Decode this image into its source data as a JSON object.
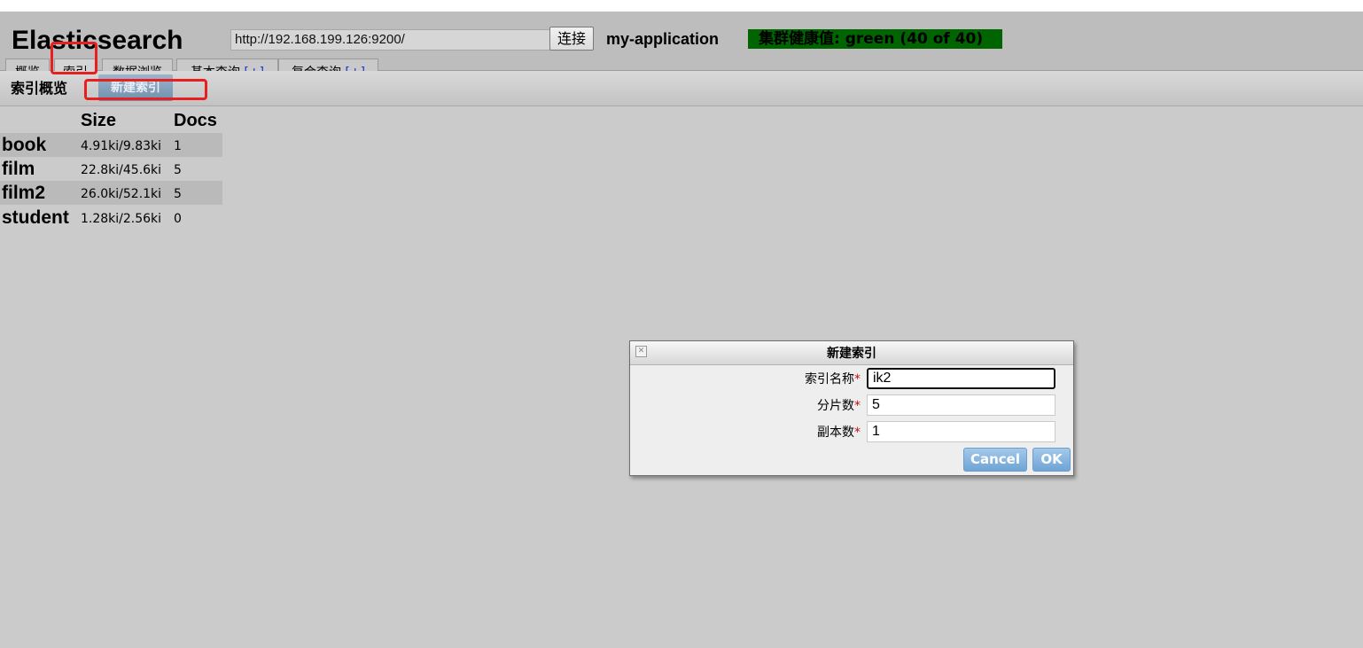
{
  "app": {
    "title": "Elasticsearch",
    "url_value": "http://192.168.199.126:9200/",
    "connect_label": "连接",
    "cluster_name": "my-application",
    "health_text": "集群健康值: green (40 of 40)",
    "health_color": "#006400"
  },
  "tabs": [
    {
      "label": "概览"
    },
    {
      "label": "索引"
    },
    {
      "label": "数据浏览"
    },
    {
      "label": "基本查询",
      "plus": "[+]"
    },
    {
      "label": "复合查询",
      "plus": "[+]"
    }
  ],
  "subbar": {
    "title": "索引概览",
    "new_index_label": "新建索引"
  },
  "index_table": {
    "headers": {
      "size": "Size",
      "docs": "Docs"
    },
    "rows": [
      {
        "name": "book",
        "size": "4.91ki/9.83ki",
        "docs": "1"
      },
      {
        "name": "film",
        "size": "22.8ki/45.6ki",
        "docs": "5"
      },
      {
        "name": "film2",
        "size": "26.0ki/52.1ki",
        "docs": "5"
      },
      {
        "name": "student",
        "size": "1.28ki/2.56ki",
        "docs": "0"
      }
    ]
  },
  "dialog": {
    "title": "新建索引",
    "close_icon": "close-icon",
    "fields": [
      {
        "label": "索引名称",
        "required": "*",
        "value": "ik2"
      },
      {
        "label": "分片数",
        "required": "*",
        "value": "5"
      },
      {
        "label": "副本数",
        "required": "*",
        "value": "1"
      }
    ],
    "cancel_label": "Cancel",
    "ok_label": "OK",
    "accent_color": "#6ea4d6"
  },
  "annotation_color": "#e81f1f"
}
